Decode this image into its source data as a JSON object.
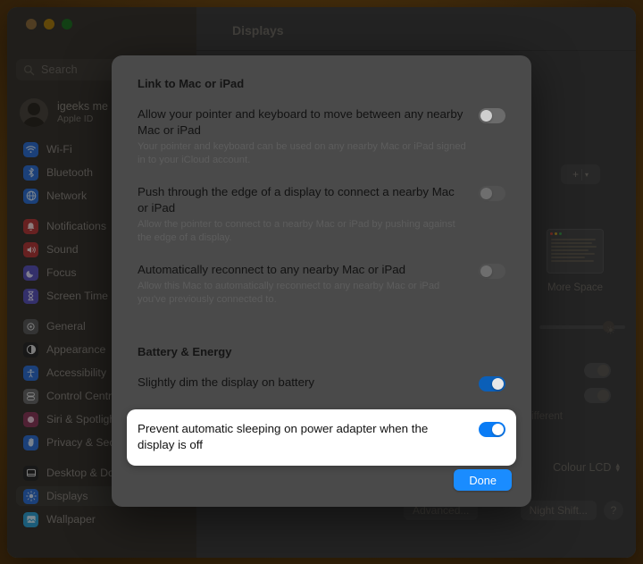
{
  "window": {
    "title": "Displays",
    "traffic_lights": [
      "close",
      "minimize",
      "zoom"
    ]
  },
  "sidebar": {
    "search": {
      "placeholder": "Search",
      "icon": "search-icon"
    },
    "account": {
      "name": "igeeks me",
      "subtitle": "Apple ID",
      "avatar": "user-avatar"
    },
    "groups": [
      {
        "items": [
          {
            "label": "Wi-Fi",
            "icon": "wifi-icon",
            "color": "#2f6fd0"
          },
          {
            "label": "Bluetooth",
            "icon": "bluetooth-icon",
            "color": "#2f6fd0"
          },
          {
            "label": "Network",
            "icon": "network-icon",
            "color": "#2f6fd0"
          }
        ]
      },
      {
        "items": [
          {
            "label": "Notifications",
            "icon": "bell-icon",
            "color": "#b23a3a"
          },
          {
            "label": "Sound",
            "icon": "speaker-icon",
            "color": "#b23a3a"
          },
          {
            "label": "Focus",
            "icon": "moon-icon",
            "color": "#5a54b8"
          },
          {
            "label": "Screen Time",
            "icon": "hourglass-icon",
            "color": "#5a54b8"
          }
        ]
      },
      {
        "items": [
          {
            "label": "General",
            "icon": "gear-icon",
            "color": "#5a5a5a"
          },
          {
            "label": "Appearance",
            "icon": "appearance-icon",
            "color": "#2a2a2a"
          },
          {
            "label": "Accessibility",
            "icon": "accessibility-icon",
            "color": "#2f6fd0"
          },
          {
            "label": "Control Centre",
            "icon": "control-centre-icon",
            "color": "#6a6a6a"
          },
          {
            "label": "Siri & Spotlight",
            "icon": "siri-icon",
            "color": "#8a3a5a"
          },
          {
            "label": "Privacy & Security",
            "icon": "hand-icon",
            "color": "#2f6fd0"
          }
        ]
      },
      {
        "items": [
          {
            "label": "Desktop & Dock",
            "icon": "desktop-dock-icon",
            "color": "#2a2a2a"
          },
          {
            "label": "Displays",
            "icon": "displays-icon",
            "color": "#2f6fd0",
            "selected": true
          },
          {
            "label": "Wallpaper",
            "icon": "wallpaper-icon",
            "color": "#2f9fd0"
          }
        ]
      }
    ]
  },
  "content": {
    "title": "Displays",
    "add_button": {
      "label": "+",
      "chevron": "chevron-down-icon"
    },
    "display_thumbnail_caption": "More Space",
    "brightness_label": "brightness-slider",
    "background_toggle_label": "different",
    "profile_popup": {
      "value": "Colour LCD"
    },
    "buttons": {
      "advanced": "Advanced...",
      "night_shift": "Night Shift...",
      "help": "?"
    }
  },
  "sheet": {
    "sections": [
      {
        "title": "Link to Mac or iPad",
        "rows": [
          {
            "title": "Allow your pointer and keyboard to move between any nearby Mac or iPad",
            "subtitle": "Your pointer and keyboard can be used on any nearby Mac or iPad signed in to your iCloud account.",
            "toggle": "off"
          },
          {
            "title": "Push through the edge of a display to connect a nearby Mac or iPad",
            "subtitle": "Allow the pointer to connect to a nearby Mac or iPad by pushing against the edge of a display.",
            "toggle": "disabled"
          },
          {
            "title": "Automatically reconnect to any nearby Mac or iPad",
            "subtitle": "Allow this Mac to automatically reconnect to any nearby Mac or iPad you've previously connected to.",
            "toggle": "disabled"
          }
        ]
      },
      {
        "title": "Battery & Energy",
        "rows": [
          {
            "title": "Slightly dim the display on battery",
            "subtitle": "",
            "toggle": "on"
          },
          {
            "title": "Prevent automatic sleeping on power adapter when the display is off",
            "subtitle": "",
            "toggle": "on",
            "highlighted": true
          }
        ]
      }
    ],
    "done_label": "Done"
  },
  "colors": {
    "accent_blue": "#1a8cff",
    "toggle_on": "#0a7cf5",
    "sheet_bg": "#4a4a4a",
    "highlight_bg": "#ffffff"
  }
}
